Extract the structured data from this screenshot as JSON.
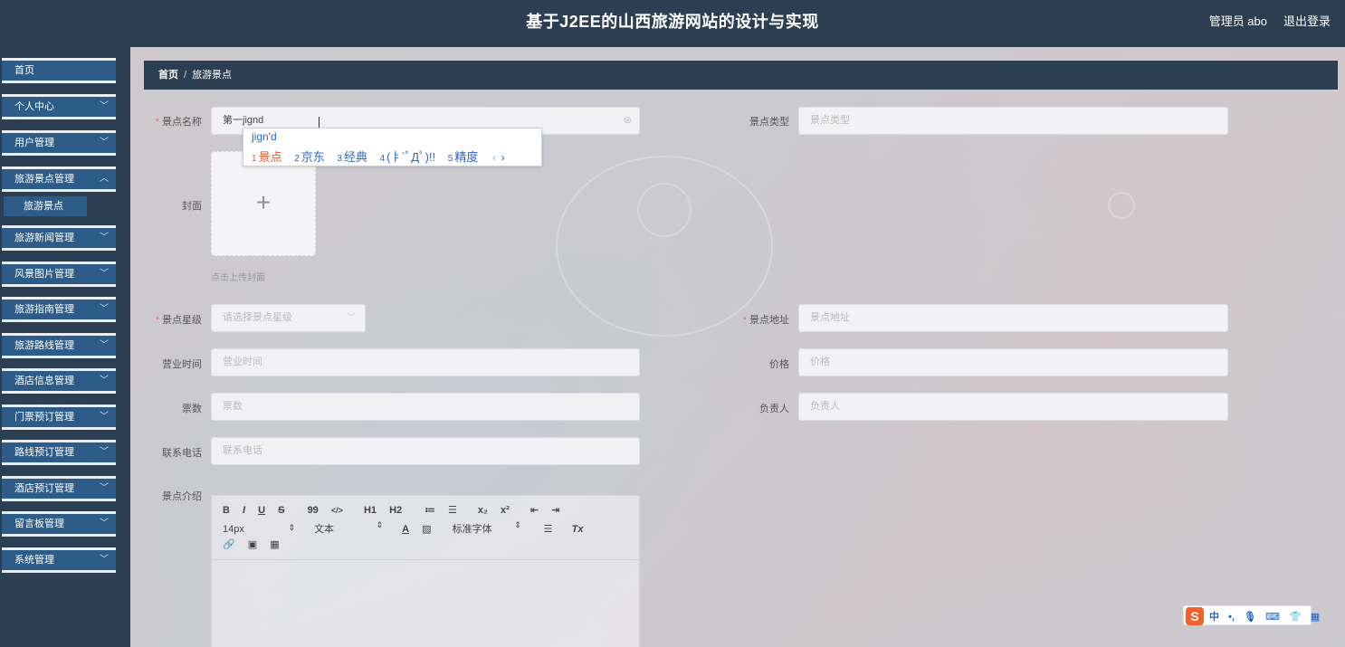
{
  "header": {
    "title": "基于J2EE的山西旅游网站的设计与实现",
    "admin": "管理员 abo",
    "logout": "退出登录"
  },
  "sidebar": {
    "items": [
      {
        "label": "首页"
      },
      {
        "label": "个人中心",
        "chevron": "﹀"
      },
      {
        "label": "用户管理",
        "chevron": "﹀"
      },
      {
        "label": "旅游景点管理",
        "chevron": "︿"
      },
      {
        "label": "旅游新闻管理",
        "chevron": "﹀"
      },
      {
        "label": "风景图片管理",
        "chevron": "﹀"
      },
      {
        "label": "旅游指南管理",
        "chevron": "﹀"
      },
      {
        "label": "旅游路线管理",
        "chevron": "﹀"
      },
      {
        "label": "酒店信息管理",
        "chevron": "﹀"
      },
      {
        "label": "门票预订管理",
        "chevron": "﹀"
      },
      {
        "label": "路线预订管理",
        "chevron": "﹀"
      },
      {
        "label": "酒店预订管理",
        "chevron": "﹀"
      },
      {
        "label": "留言板管理",
        "chevron": "﹀"
      },
      {
        "label": "系统管理",
        "chevron": "﹀"
      }
    ],
    "subitem": "旅游景点"
  },
  "breadcrumb": {
    "home": "首页",
    "separator": "/",
    "current": "旅游景点"
  },
  "form": {
    "name": {
      "label": "景点名称",
      "value": "第一jignd"
    },
    "type": {
      "label": "景点类型",
      "placeholder": "景点类型"
    },
    "cover": {
      "label": "封面",
      "plus": "+",
      "hint": "点击上传封面"
    },
    "star": {
      "label": "景点星级",
      "placeholder": "请选择景点星级"
    },
    "address": {
      "label": "景点地址",
      "placeholder": "景点地址"
    },
    "hours": {
      "label": "营业时间",
      "placeholder": "营业时间"
    },
    "price": {
      "label": "价格",
      "placeholder": "价格"
    },
    "tickets": {
      "label": "票数",
      "placeholder": "票数"
    },
    "manager": {
      "label": "负责人",
      "placeholder": "负责人"
    },
    "phone": {
      "label": "联系电话",
      "placeholder": "联系电话"
    },
    "intro": {
      "label": "景点介绍"
    }
  },
  "ime_popup": {
    "composition": "jign'd",
    "candidates": [
      {
        "num": "1",
        "text": "景点"
      },
      {
        "num": "2",
        "text": "京东"
      },
      {
        "num": "3",
        "text": "经典"
      },
      {
        "num": "4",
        "text": "(ㅑ`ﾟДﾟ)!!"
      },
      {
        "num": "5",
        "text": "精度"
      }
    ],
    "prev": "‹",
    "next": "›"
  },
  "editor": {
    "row1": [
      "B",
      "I",
      "U",
      "S",
      "99",
      "</>",
      "H1",
      "H2",
      "≔",
      "☰",
      "x₂",
      "x²",
      "⇤",
      "⇥"
    ],
    "size": "14px",
    "text_style": "文本",
    "font": "标准字体",
    "row2_icons": [
      "A",
      "▨",
      "☰",
      "Tx"
    ],
    "row3": [
      "🔗",
      "▣",
      "▦"
    ]
  },
  "imebar": {
    "logo": "S",
    "items": [
      "中",
      "•,",
      "🎙",
      "⌨",
      "👕",
      "▦"
    ]
  },
  "colors": {
    "header_bg": "#2c3e51",
    "sidebar_item_bg": "#2e5c89",
    "required": "#f56c6c",
    "ime_blue": "#2b67c9",
    "ime_active": "#e4572e"
  }
}
